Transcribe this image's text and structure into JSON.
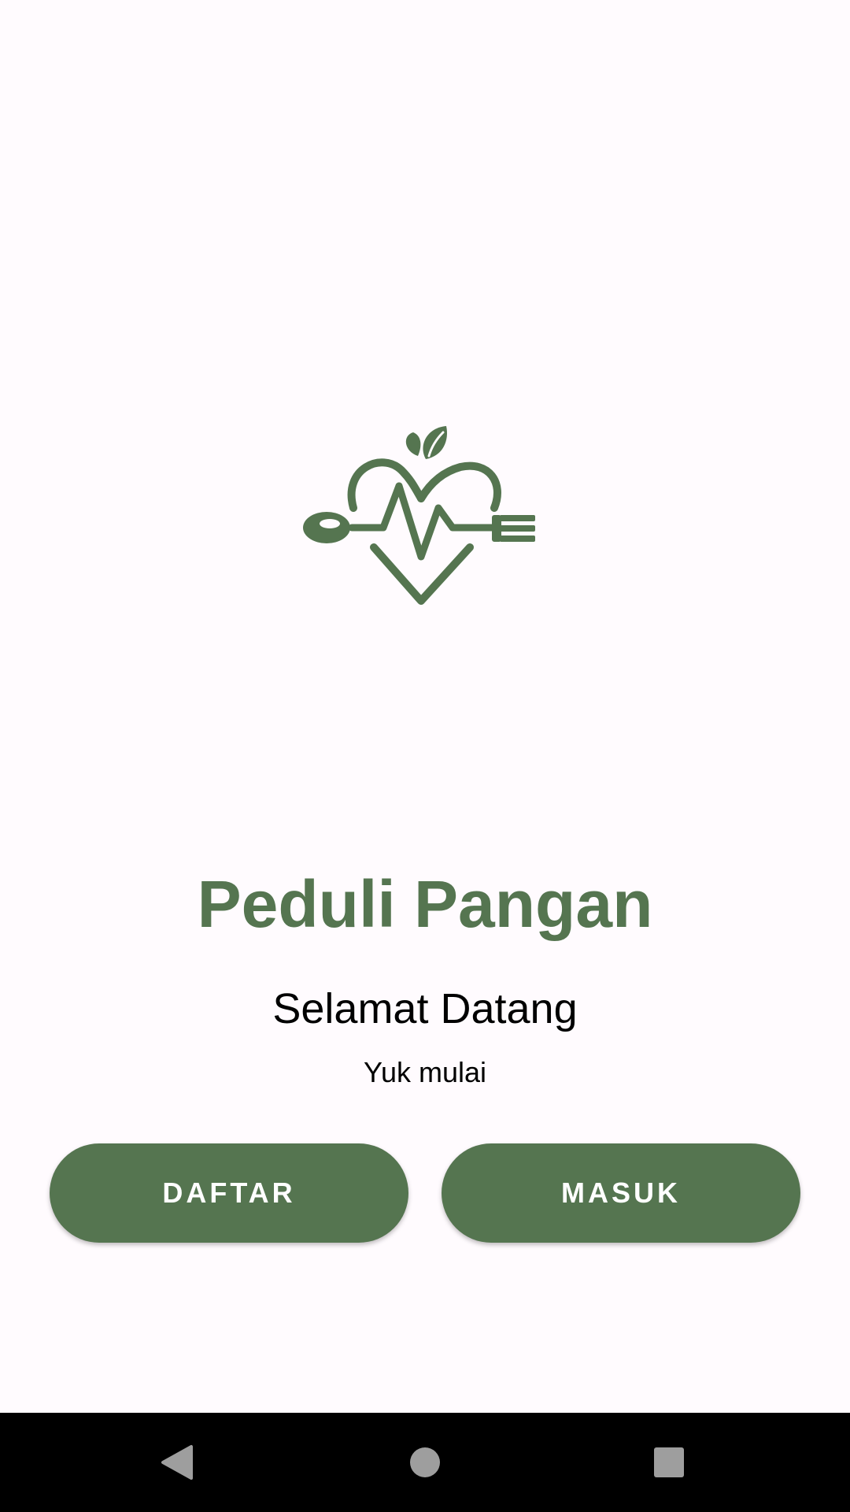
{
  "app": {
    "title": "Peduli Pangan",
    "welcome": "Selamat Datang",
    "subtitle": "Yuk mulai"
  },
  "buttons": {
    "register_label": "DAFTAR",
    "login_label": "MASUK"
  },
  "logo": {
    "icon": "heart-apple-spoon-fork-heartbeat-icon"
  },
  "navigation_bar": {
    "back_icon": "back-triangle-icon",
    "home_icon": "home-circle-icon",
    "recents_icon": "recents-square-icon"
  },
  "colors": {
    "brand": "#557550",
    "background": "#fffbfe",
    "nav_background": "#000000",
    "nav_icon": "#9e9e9e"
  }
}
